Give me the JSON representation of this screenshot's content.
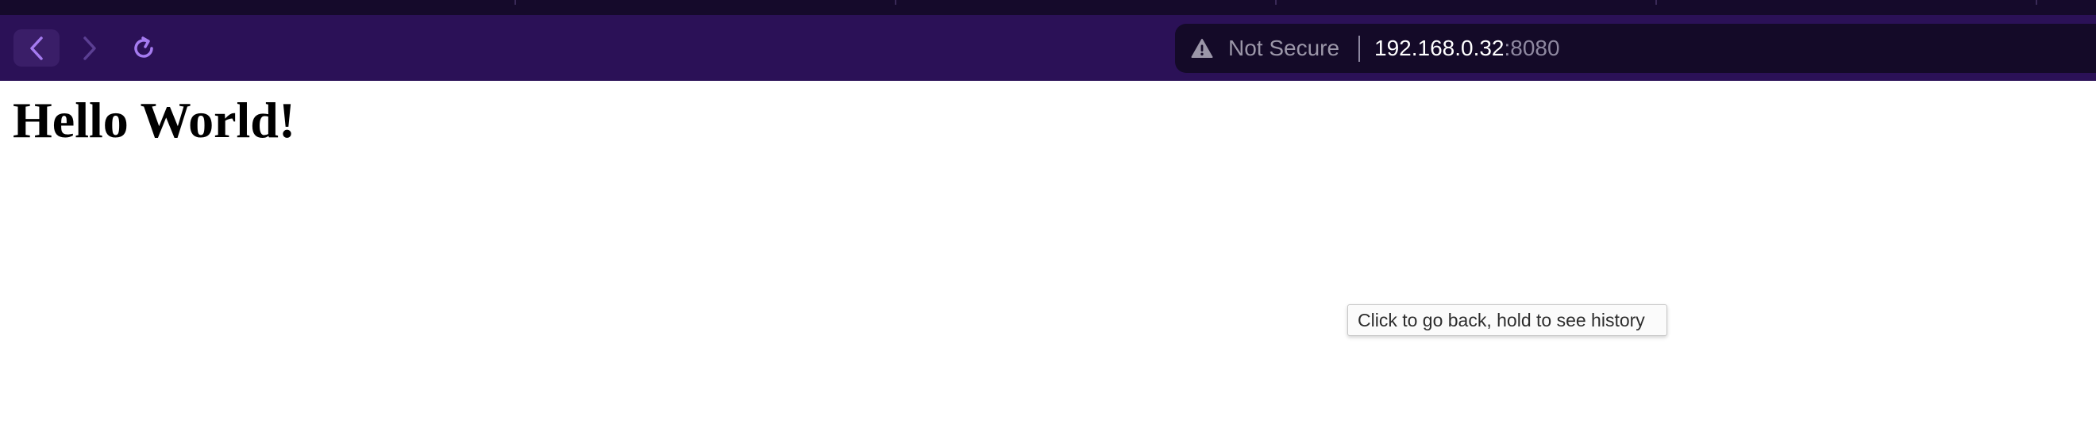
{
  "browser": {
    "tab_strip_color": "#150a2b",
    "toolbar_color": "#2b1157",
    "icons": {
      "back": "chevron-left-icon",
      "forward": "chevron-right-icon",
      "reload": "reload-icon",
      "security": "warning-triangle-icon"
    },
    "address_bar": {
      "security_label": "Not Secure",
      "host": "192.168.0.32",
      "port": ":8080"
    }
  },
  "page": {
    "heading": "Hello World!"
  },
  "tooltip": {
    "text": "Click to go back, hold to see history"
  },
  "colors": {
    "accent_icon": "#a57bf0",
    "disabled_icon": "#5b3f93"
  }
}
